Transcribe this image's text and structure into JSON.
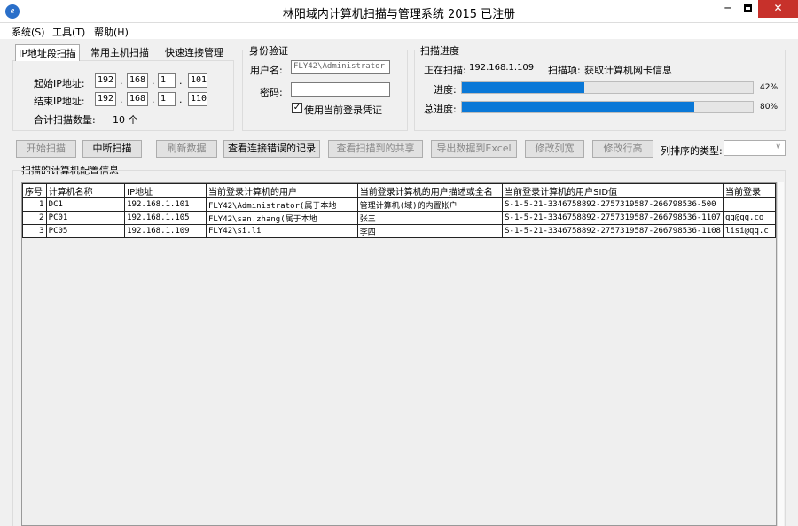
{
  "window": {
    "title": "林阳域内计算机扫描与管理系统 2015 已注册",
    "icon_letter": "e"
  },
  "menu": [
    {
      "label": "系统(S)"
    },
    {
      "label": "工具(T)"
    },
    {
      "label": "帮助(H)"
    }
  ],
  "tabs": [
    {
      "label": "IP地址段扫描"
    },
    {
      "label": "常用主机扫描"
    },
    {
      "label": "快速连接管理"
    }
  ],
  "ip_range": {
    "start_label": "起始IP地址:",
    "end_label": "结束IP地址:",
    "start": [
      "192",
      "168",
      "1",
      "101"
    ],
    "end": [
      "192",
      "168",
      "1",
      "110"
    ],
    "count_label": "合计扫描数量:",
    "count_value": "10 个"
  },
  "auth": {
    "group_title": "身份验证",
    "username_label": "用户名:",
    "username_value": "FLY42\\Administrator",
    "password_label": "密码:",
    "password_value": "",
    "use_current_label": "使用当前登录凭证",
    "use_current_checked": true
  },
  "progress": {
    "group_title": "扫描进度",
    "scanning_label": "正在扫描:",
    "scanning_ip": "192.168.1.109",
    "item_label": "扫描项:",
    "item_value": "获取计算机网卡信息",
    "progress_label": "进度:",
    "progress_percent": 42,
    "progress_text": "42%",
    "total_label": "总进度:",
    "total_percent": 80,
    "total_text": "80%"
  },
  "toolbar": {
    "start": "开始扫描",
    "stop": "中断扫描",
    "refresh": "刷新数据",
    "errors": "查看连接错误的记录",
    "shares": "查看扫描到的共享",
    "export": "导出数据到Excel",
    "edit_columns": "修改列宽",
    "edit_rows": "修改行高",
    "sort_label": "列排序的类型:",
    "sort_value": ""
  },
  "grid": {
    "title": "扫描的计算机配置信息",
    "columns": [
      "序号",
      "计算机名称",
      "IP地址",
      "当前登录计算机的用户",
      "当前登录计算机的用户描述或全名",
      "当前登录计算机的用户SID值",
      "当前登录"
    ],
    "rows": [
      [
        "1",
        "DC1",
        "192.168.1.101",
        "FLY42\\Administrator(属于本地",
        "管理计算机(域)的内置帐户",
        "S-1-5-21-3346758892-2757319587-266798536-500",
        ""
      ],
      [
        "2",
        "PC01",
        "192.168.1.105",
        "FLY42\\san.zhang(属于本地",
        "张三",
        "S-1-5-21-3346758892-2757319587-266798536-1107",
        "qq@qq.co"
      ],
      [
        "3",
        "PC05",
        "192.168.1.109",
        "FLY42\\si.li",
        "李四",
        "S-1-5-21-3346758892-2757319587-266798536-1108",
        "lisi@qq.c"
      ]
    ]
  }
}
